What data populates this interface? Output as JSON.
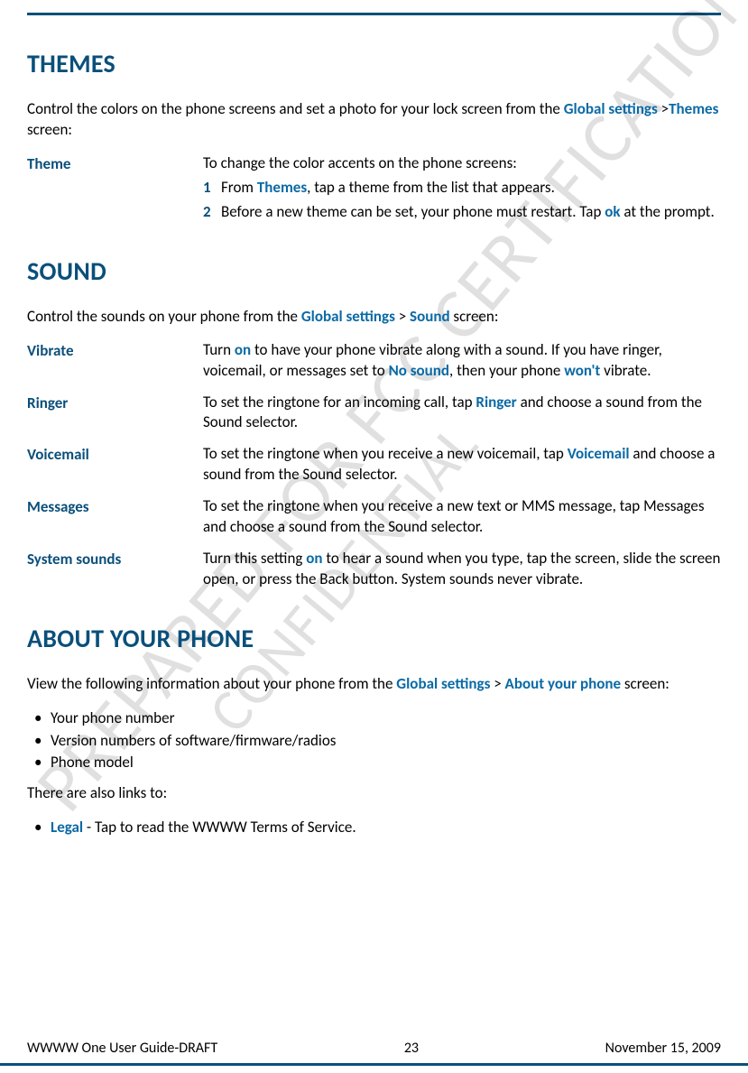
{
  "watermarks": {
    "w1": "PREPARED FOR FCC CERTIFICATION",
    "w2": "CONFIDENTIAL"
  },
  "themes": {
    "heading": "THEMES",
    "intro_pre": "Control the colors on the phone screens and set a photo for your lock screen from the ",
    "intro_emph1": "Global settings",
    "intro_mid": " >",
    "intro_emph2": "Themes",
    "intro_post": " screen:",
    "theme_label": "Theme",
    "theme_body_intro": "To change the color accents on the phone screens:",
    "step1_n": "1",
    "step1_pre": "From ",
    "step1_emph": "Themes",
    "step1_post": ", tap a theme from the list that appears.",
    "step2_n": "2",
    "step2_pre": "Before a new theme can be set, your phone must restart. Tap ",
    "step2_emph": "ok",
    "step2_post": " at the prompt."
  },
  "sound": {
    "heading": "SOUND",
    "intro_pre": "Control the sounds on your phone from the ",
    "intro_emph1": "Global settings",
    "intro_mid": " > ",
    "intro_emph2": "Sound",
    "intro_post": " screen:",
    "vibrate_label": "Vibrate",
    "vibrate_pre": "Turn ",
    "vibrate_on": "on",
    "vibrate_mid": " to have your phone vibrate along with a sound. If you have ringer, voicemail, or messages set to ",
    "vibrate_nosound": "No sound",
    "vibrate_mid2": ", then your phone ",
    "vibrate_wont": "won't",
    "vibrate_post": " vibrate.",
    "ringer_label": "Ringer",
    "ringer_pre": "To set the ringtone for an incoming call, tap ",
    "ringer_emph": "Ringer",
    "ringer_post": " and choose a sound from the Sound selector.",
    "voicemail_label": "Voicemail",
    "voicemail_pre": "To set the ringtone when you receive a new voicemail, tap ",
    "voicemail_emph": "Voicemail",
    "voicemail_post": " and choose a sound from the Sound selector.",
    "messages_label": "Messages",
    "messages_body": "To set the ringtone when you receive a new text or MMS message, tap Messages and choose a sound from the Sound selector.",
    "system_label": "System sounds",
    "system_pre": "Turn this setting ",
    "system_on": "on",
    "system_post": " to hear a sound when you type, tap the screen, slide the screen open, or press the Back button. System sounds never vibrate."
  },
  "about": {
    "heading": "ABOUT YOUR PHONE",
    "intro_pre": "View the following information about your phone from the ",
    "intro_emph1": "Global settings",
    "intro_mid": " > ",
    "intro_emph2": "About your phone",
    "intro_post": " screen:",
    "b1": "Your phone number",
    "b2": "Version numbers of software/firmware/radios",
    "b3": "Phone model",
    "also": "There are also links to:",
    "legal_emph": "Legal",
    "legal_post": " - Tap to read the WWWW Terms of Service."
  },
  "footer": {
    "left": "WWWW One User Guide-DRAFT",
    "center": "23",
    "right": "November 15, 2009"
  }
}
